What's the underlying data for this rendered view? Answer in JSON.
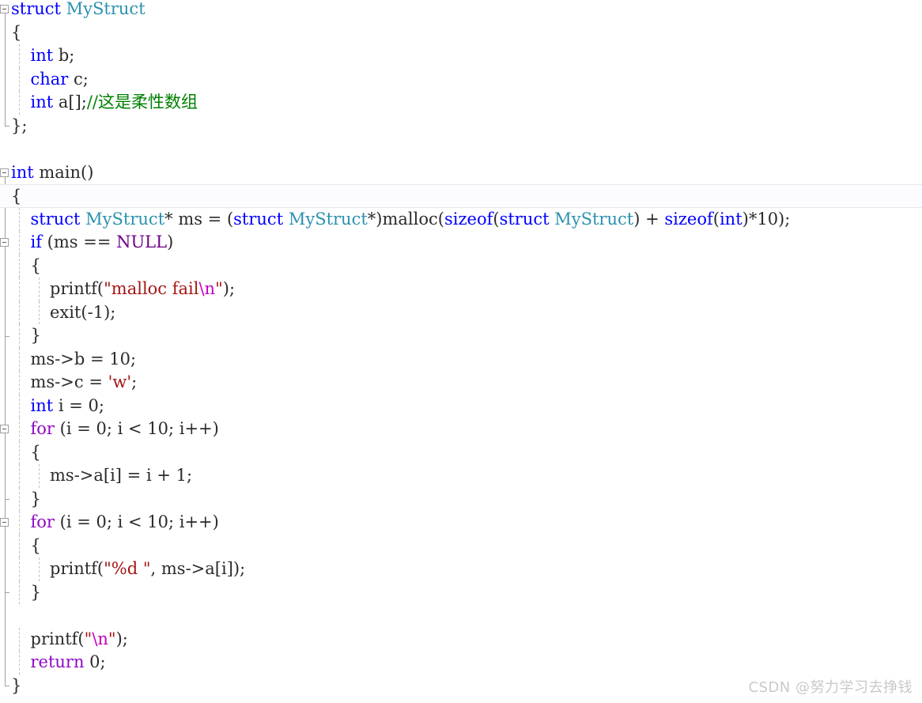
{
  "editor": {
    "app": "visual-studio-code-editor",
    "language": "C",
    "font_size_px": 21,
    "line_height_px": 29.5,
    "background": "#ffffff",
    "current_line_index": 8,
    "colors": {
      "keyword": "#0000ff",
      "control_keyword": "#8f08c4",
      "user_type": "#2b91af",
      "macro": "#6f008a",
      "string": "#a31515",
      "escape": "#c000c0",
      "comment": "#008000",
      "identifier": "#2b2b2b",
      "gutter_marker": "#a0a0a0",
      "indent_guide": "#bfbfbf",
      "current_line_border": "#e6e6ee",
      "watermark": "#c9c9c9"
    }
  },
  "code": {
    "lines": [
      {
        "indent": 0,
        "tokens": [
          {
            "t": "struct",
            "c": "kw"
          },
          {
            "t": " ",
            "c": "id"
          },
          {
            "t": "MyStruct",
            "c": "type"
          }
        ]
      },
      {
        "indent": 0,
        "tokens": [
          {
            "t": "{",
            "c": "id"
          }
        ]
      },
      {
        "indent": 1,
        "tokens": [
          {
            "t": "int",
            "c": "kw"
          },
          {
            "t": " b;",
            "c": "id"
          }
        ]
      },
      {
        "indent": 1,
        "tokens": [
          {
            "t": "char",
            "c": "kw"
          },
          {
            "t": " c;",
            "c": "id"
          }
        ]
      },
      {
        "indent": 1,
        "tokens": [
          {
            "t": "int",
            "c": "kw"
          },
          {
            "t": " a[];",
            "c": "id"
          },
          {
            "t": "//这是柔性数组",
            "c": "cmt"
          }
        ]
      },
      {
        "indent": 0,
        "tokens": [
          {
            "t": "};",
            "c": "id"
          }
        ]
      },
      {
        "indent": 0,
        "tokens": [
          {
            "t": "",
            "c": "id"
          }
        ]
      },
      {
        "indent": 0,
        "tokens": [
          {
            "t": "int",
            "c": "kw"
          },
          {
            "t": " main()",
            "c": "id"
          }
        ]
      },
      {
        "indent": 0,
        "tokens": [
          {
            "t": "{",
            "c": "id"
          }
        ]
      },
      {
        "indent": 1,
        "tokens": [
          {
            "t": "struct",
            "c": "kw"
          },
          {
            "t": " ",
            "c": "id"
          },
          {
            "t": "MyStruct",
            "c": "type"
          },
          {
            "t": "* ms = (",
            "c": "id"
          },
          {
            "t": "struct",
            "c": "kw"
          },
          {
            "t": " ",
            "c": "id"
          },
          {
            "t": "MyStruct",
            "c": "type"
          },
          {
            "t": "*)malloc(",
            "c": "id"
          },
          {
            "t": "sizeof",
            "c": "kw"
          },
          {
            "t": "(",
            "c": "id"
          },
          {
            "t": "struct",
            "c": "kw"
          },
          {
            "t": " ",
            "c": "id"
          },
          {
            "t": "MyStruct",
            "c": "type"
          },
          {
            "t": ") + ",
            "c": "id"
          },
          {
            "t": "sizeof",
            "c": "kw"
          },
          {
            "t": "(",
            "c": "id"
          },
          {
            "t": "int",
            "c": "kw"
          },
          {
            "t": ")*10);",
            "c": "id"
          }
        ]
      },
      {
        "indent": 1,
        "tokens": [
          {
            "t": "if",
            "c": "kw"
          },
          {
            "t": " (ms == ",
            "c": "id"
          },
          {
            "t": "NULL",
            "c": "macro"
          },
          {
            "t": ")",
            "c": "id"
          }
        ]
      },
      {
        "indent": 1,
        "tokens": [
          {
            "t": "{",
            "c": "id"
          }
        ]
      },
      {
        "indent": 2,
        "tokens": [
          {
            "t": "printf(",
            "c": "id"
          },
          {
            "t": "\"malloc fail",
            "c": "str"
          },
          {
            "t": "\\n",
            "c": "esc"
          },
          {
            "t": "\"",
            "c": "str"
          },
          {
            "t": ");",
            "c": "id"
          }
        ]
      },
      {
        "indent": 2,
        "tokens": [
          {
            "t": "exit(-1);",
            "c": "id"
          }
        ]
      },
      {
        "indent": 1,
        "tokens": [
          {
            "t": "}",
            "c": "id"
          }
        ]
      },
      {
        "indent": 1,
        "tokens": [
          {
            "t": "ms->b = 10;",
            "c": "id"
          }
        ]
      },
      {
        "indent": 1,
        "tokens": [
          {
            "t": "ms->c = ",
            "c": "id"
          },
          {
            "t": "'w'",
            "c": "str"
          },
          {
            "t": ";",
            "c": "id"
          }
        ]
      },
      {
        "indent": 1,
        "tokens": [
          {
            "t": "int",
            "c": "kw"
          },
          {
            "t": " i = 0;",
            "c": "id"
          }
        ]
      },
      {
        "indent": 1,
        "tokens": [
          {
            "t": "for",
            "c": "kwc"
          },
          {
            "t": " (i = 0; i < 10; i++)",
            "c": "id"
          }
        ]
      },
      {
        "indent": 1,
        "tokens": [
          {
            "t": "{",
            "c": "id"
          }
        ]
      },
      {
        "indent": 2,
        "tokens": [
          {
            "t": "ms->a[i] = i + 1;",
            "c": "id"
          }
        ]
      },
      {
        "indent": 1,
        "tokens": [
          {
            "t": "}",
            "c": "id"
          }
        ]
      },
      {
        "indent": 1,
        "tokens": [
          {
            "t": "for",
            "c": "kwc"
          },
          {
            "t": " (i = 0; i < 10; i++)",
            "c": "id"
          }
        ]
      },
      {
        "indent": 1,
        "tokens": [
          {
            "t": "{",
            "c": "id"
          }
        ]
      },
      {
        "indent": 2,
        "tokens": [
          {
            "t": "printf(",
            "c": "id"
          },
          {
            "t": "\"%d \"",
            "c": "str"
          },
          {
            "t": ", ms->a[i]);",
            "c": "id"
          }
        ]
      },
      {
        "indent": 1,
        "tokens": [
          {
            "t": "}",
            "c": "id"
          }
        ]
      },
      {
        "indent": 0,
        "tokens": [
          {
            "t": "",
            "c": "id"
          }
        ]
      },
      {
        "indent": 1,
        "tokens": [
          {
            "t": "printf(",
            "c": "id"
          },
          {
            "t": "\"",
            "c": "str"
          },
          {
            "t": "\\n",
            "c": "esc"
          },
          {
            "t": "\"",
            "c": "str"
          },
          {
            "t": ");",
            "c": "id"
          }
        ]
      },
      {
        "indent": 1,
        "tokens": [
          {
            "t": "return",
            "c": "kwc"
          },
          {
            "t": " 0;",
            "c": "id"
          }
        ]
      },
      {
        "indent": 0,
        "tokens": [
          {
            "t": "}",
            "c": "id"
          }
        ]
      }
    ]
  },
  "gutter": {
    "fold_markers": [
      {
        "line": 0,
        "state": "expanded"
      },
      {
        "line": 7,
        "state": "expanded"
      },
      {
        "line": 10,
        "state": "expanded"
      },
      {
        "line": 18,
        "state": "expanded"
      },
      {
        "line": 22,
        "state": "expanded"
      }
    ],
    "fold_regions": [
      {
        "from": 0,
        "to": 5
      },
      {
        "from": 7,
        "to": 29
      },
      {
        "from": 10,
        "to": 14
      },
      {
        "from": 18,
        "to": 21
      },
      {
        "from": 22,
        "to": 25
      }
    ]
  },
  "watermark": {
    "text": "CSDN @努力学习去挣钱"
  }
}
